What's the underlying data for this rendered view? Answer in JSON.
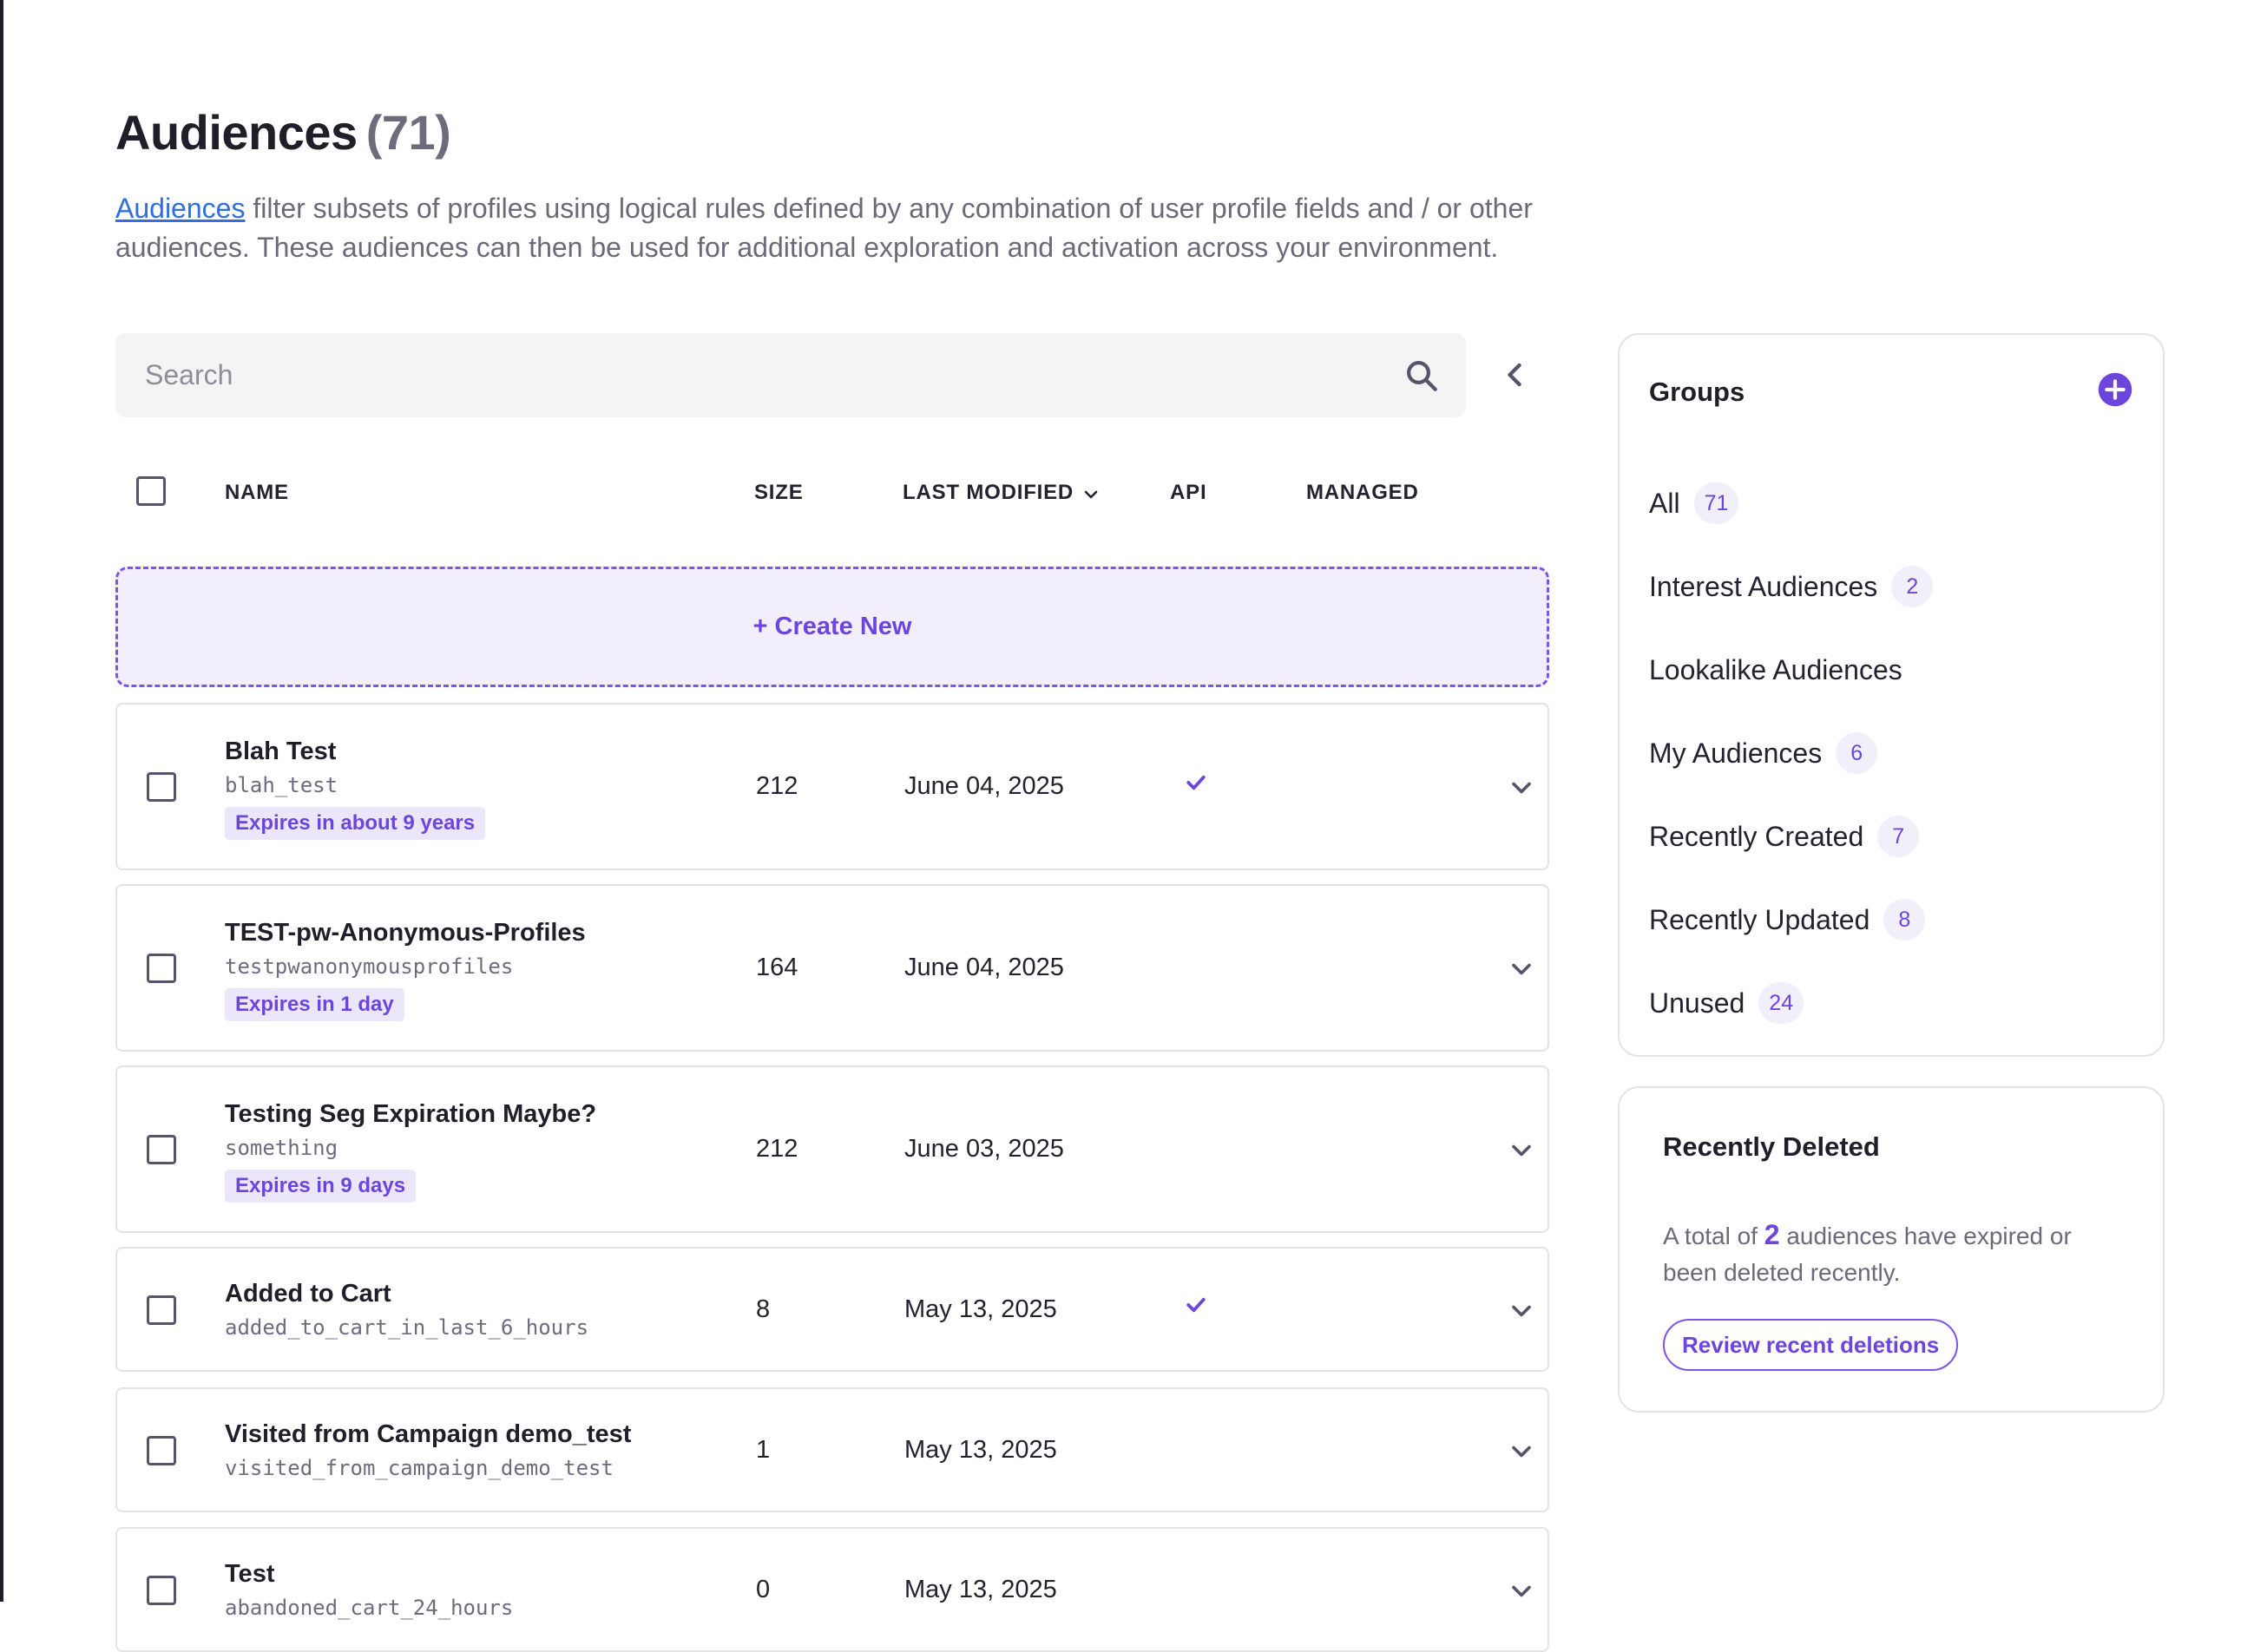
{
  "header": {
    "title": "Audiences",
    "count": "(71)",
    "description_link": "Audiences",
    "description_rest": " filter subsets of profiles using logical rules defined by any combination of user profile fields and / or other audiences. These audiences can then be used for additional exploration and activation across your environment."
  },
  "search": {
    "placeholder": "Search"
  },
  "table": {
    "columns": {
      "name": "NAME",
      "size": "SIZE",
      "last_modified": "LAST MODIFIED",
      "api": "API",
      "managed": "MANAGED"
    },
    "create_label": "+ Create New",
    "rows": [
      {
        "name": "Blah Test",
        "slug": "blah_test",
        "badge": "Expires in about 9 years",
        "size": "212",
        "date": "June 04, 2025",
        "api": true
      },
      {
        "name": "TEST-pw-Anonymous-Profiles",
        "slug": "testpwanonymousprofiles",
        "badge": "Expires in 1 day",
        "size": "164",
        "date": "June 04, 2025",
        "api": false
      },
      {
        "name": "Testing Seg Expiration Maybe?",
        "slug": "something",
        "badge": "Expires in 9 days",
        "size": "212",
        "date": "June 03, 2025",
        "api": false
      },
      {
        "name": "Added to Cart",
        "slug": "added_to_cart_in_last_6_hours",
        "badge": "",
        "size": "8",
        "date": "May 13, 2025",
        "api": true
      },
      {
        "name": "Visited from Campaign demo_test",
        "slug": "visited_from_campaign_demo_test",
        "badge": "",
        "size": "1",
        "date": "May 13, 2025",
        "api": false
      },
      {
        "name": "Test",
        "slug": "abandoned_cart_24_hours",
        "badge": "",
        "size": "0",
        "date": "May 13, 2025",
        "api": false
      }
    ]
  },
  "groups": {
    "title": "Groups",
    "items": [
      {
        "label": "All",
        "count": "71"
      },
      {
        "label": "Interest Audiences",
        "count": "2"
      },
      {
        "label": "Lookalike Audiences",
        "count": ""
      },
      {
        "label": "My Audiences",
        "count": "6"
      },
      {
        "label": "Recently Created",
        "count": "7"
      },
      {
        "label": "Recently Updated",
        "count": "8"
      },
      {
        "label": "Unused",
        "count": "24"
      }
    ]
  },
  "recently_deleted": {
    "title": "Recently Deleted",
    "text_before": "A total of ",
    "count": "2",
    "text_after": " audiences have expired or been deleted recently.",
    "button": "Review recent deletions"
  },
  "colors": {
    "accent": "#6b45de",
    "link": "#2f6fe0"
  }
}
